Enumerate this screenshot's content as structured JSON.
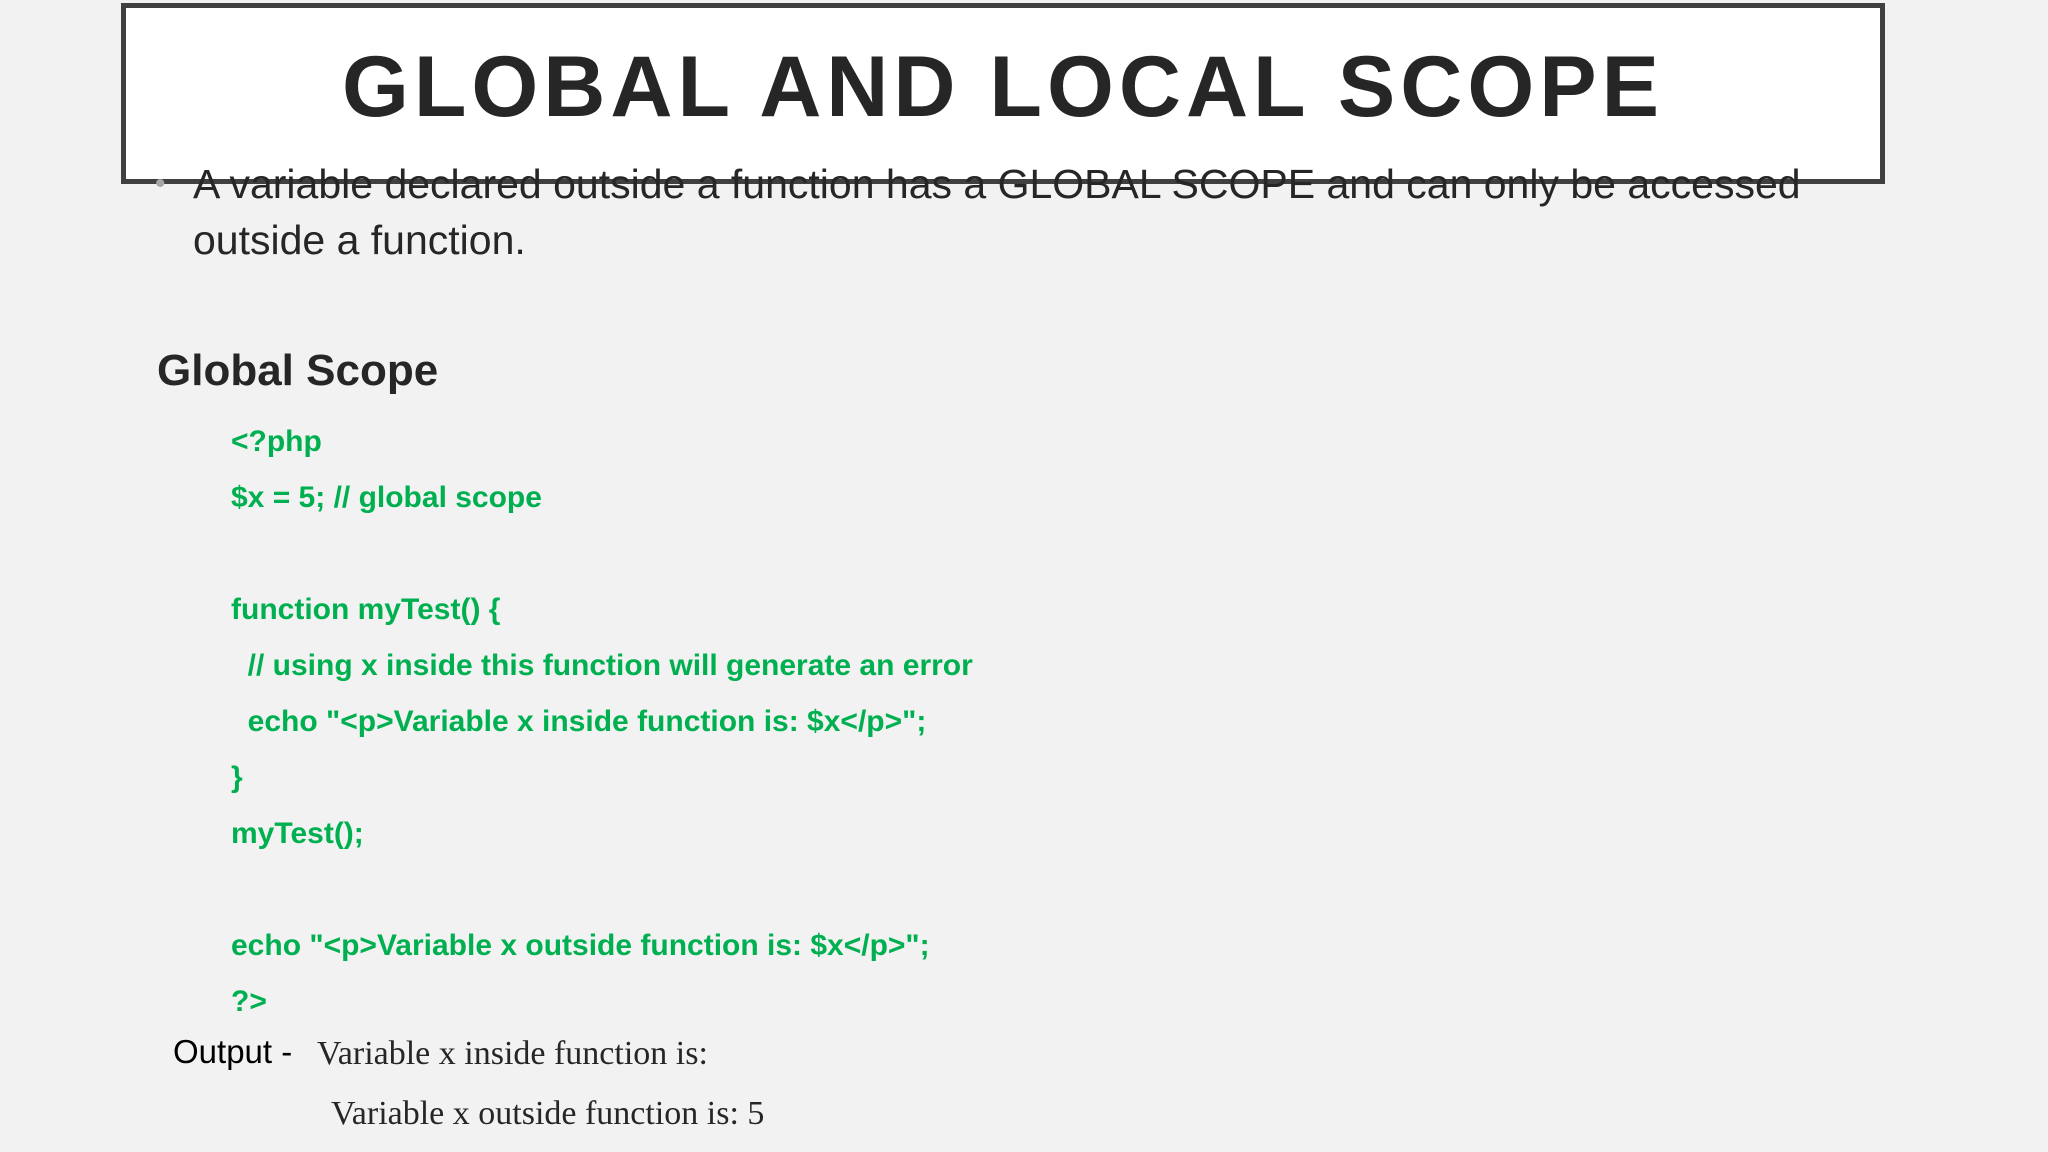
{
  "slide": {
    "title": "GLOBAL AND LOCAL SCOPE",
    "bullet": "A variable declared outside a function has a GLOBAL SCOPE and can only be accessed outside a function.",
    "bullet_marker": "•",
    "section_heading": "Global Scope",
    "code_lines": [
      "<?php",
      "$x = 5; // global scope",
      "",
      "function myTest() {",
      "  // using x inside this function will generate an error",
      "  echo \"<p>Variable x inside function is: $x</p>\";",
      "}",
      "myTest();",
      "",
      "echo \"<p>Variable x outside function is: $x</p>\";",
      "?>"
    ],
    "output_label": "Output -",
    "output_lines": [
      "Variable x inside function is:",
      "Variable x outside function is: 5"
    ]
  },
  "colors": {
    "background": "#f2f2f2",
    "title_border": "#404040",
    "text": "#262626",
    "code": "#00b050",
    "bullet_marker": "#a6a6a6"
  }
}
